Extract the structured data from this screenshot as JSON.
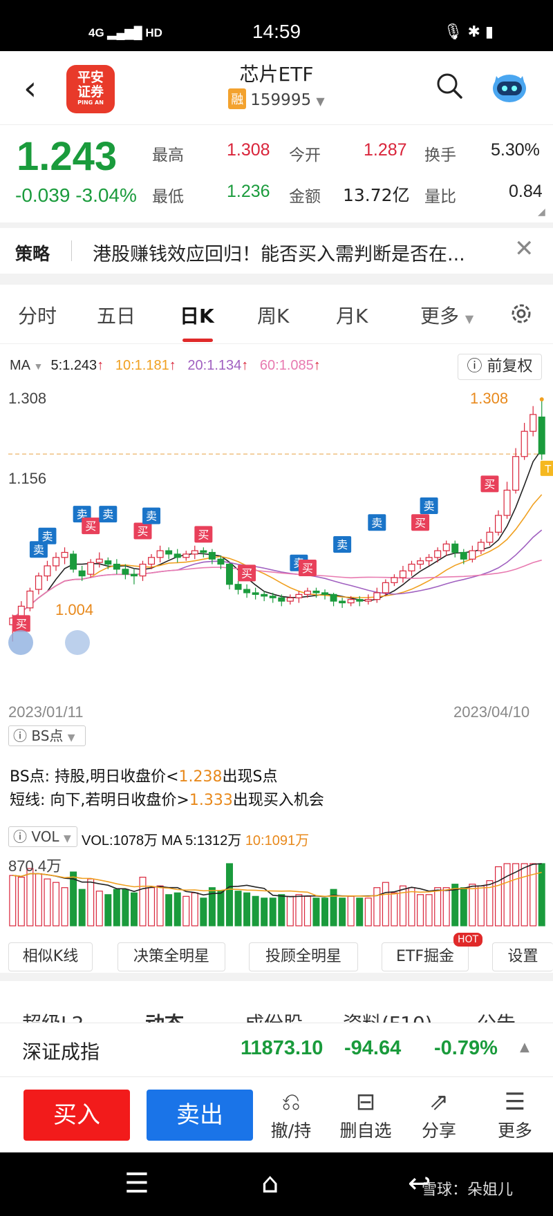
{
  "status": {
    "time": "14:59",
    "network": "4G",
    "hd": "HD"
  },
  "header": {
    "title": "芯片ETF",
    "badge": "融",
    "code": "159995",
    "logo_line1": "平安",
    "logo_line2": "证券",
    "logo_en": "PING AN"
  },
  "quote": {
    "price": "1.243",
    "change": "-0.039",
    "change_pct": "-3.04%",
    "high_label": "最高",
    "high": "1.308",
    "open_label": "今开",
    "open": "1.287",
    "turnover_label": "换手",
    "turnover": "5.30%",
    "low_label": "最低",
    "low": "1.236",
    "amount_label": "金额",
    "amount": "13.72亿",
    "ratio_label": "量比",
    "ratio": "0.84"
  },
  "strategy": {
    "label": "策略",
    "text": "港股赚钱效应回归！能否买入需判断是否在..."
  },
  "tabs": [
    "分时",
    "五日",
    "日K",
    "周K",
    "月K",
    "更多"
  ],
  "chart": {
    "ma_label": "MA",
    "ma5": "5:1.243",
    "ma10": "10:1.181",
    "ma20": "20:1.134",
    "ma60": "60:1.085",
    "fq_label": "前复权",
    "price_top": "1.308",
    "price_mid": "1.156",
    "price_low": "1.004",
    "price_max_tag": "1.308",
    "date_start": "2023/01/11",
    "date_end": "2023/04/10",
    "buy_tag": "买",
    "sell_tag": "卖",
    "t_tag": "T",
    "b_tag": "B",
    "bs_label": "BS点",
    "bs_prefix": "BS点: 持股,明日收盘价<",
    "bs_value": "1.238",
    "bs_suffix": "出现S点",
    "short_prefix": "短线: 向下,若明日收盘价>",
    "short_value": "1.333",
    "short_suffix": "出现买入机会",
    "vol_label": "VOL",
    "vol_text": "VOL:1078万 MA 5:1312万 ",
    "vol_ma10": "10:1091万",
    "vol_max": "870.4万",
    "colors": {
      "up": "#d9243a",
      "down": "#1a9b3c",
      "ma5": "#222222",
      "ma10": "#f0a020",
      "ma20": "#a060c0",
      "ma60": "#e87ab0"
    }
  },
  "chart_data": {
    "type": "candlestick",
    "x_start": "2023/01/11",
    "x_end": "2023/04/10",
    "ylim": [
      1.004,
      1.308
    ],
    "candles": [
      [
        1.04,
        1.048,
        1.02,
        1.052
      ],
      [
        1.048,
        1.062,
        1.044,
        1.068
      ],
      [
        1.06,
        1.08,
        1.056,
        1.084
      ],
      [
        1.082,
        1.098,
        1.076,
        1.102
      ],
      [
        1.098,
        1.11,
        1.092,
        1.116
      ],
      [
        1.11,
        1.12,
        1.104,
        1.126
      ],
      [
        1.12,
        1.126,
        1.112,
        1.132
      ],
      [
        1.124,
        1.106,
        1.102,
        1.128
      ],
      [
        1.104,
        1.098,
        1.092,
        1.11
      ],
      [
        1.1,
        1.114,
        1.096,
        1.118
      ],
      [
        1.114,
        1.118,
        1.108,
        1.126
      ],
      [
        1.116,
        1.112,
        1.106,
        1.12
      ],
      [
        1.112,
        1.106,
        1.1,
        1.118
      ],
      [
        1.106,
        1.1,
        1.094,
        1.112
      ],
      [
        1.1,
        1.098,
        1.088,
        1.106
      ],
      [
        1.098,
        1.112,
        1.092,
        1.116
      ],
      [
        1.112,
        1.12,
        1.106,
        1.124
      ],
      [
        1.12,
        1.128,
        1.114,
        1.134
      ],
      [
        1.128,
        1.124,
        1.118,
        1.132
      ],
      [
        1.124,
        1.12,
        1.114,
        1.13
      ],
      [
        1.12,
        1.124,
        1.116,
        1.128
      ],
      [
        1.124,
        1.128,
        1.118,
        1.134
      ],
      [
        1.128,
        1.126,
        1.12,
        1.132
      ],
      [
        1.126,
        1.118,
        1.112,
        1.13
      ],
      [
        1.118,
        1.112,
        1.106,
        1.122
      ],
      [
        1.112,
        1.088,
        1.082,
        1.114
      ],
      [
        1.088,
        1.082,
        1.076,
        1.092
      ],
      [
        1.082,
        1.078,
        1.072,
        1.088
      ],
      [
        1.078,
        1.076,
        1.07,
        1.084
      ],
      [
        1.076,
        1.074,
        1.068,
        1.08
      ],
      [
        1.074,
        1.072,
        1.066,
        1.078
      ],
      [
        1.072,
        1.068,
        1.062,
        1.076
      ],
      [
        1.068,
        1.072,
        1.064,
        1.076
      ],
      [
        1.072,
        1.076,
        1.066,
        1.08
      ],
      [
        1.076,
        1.08,
        1.072,
        1.084
      ],
      [
        1.08,
        1.078,
        1.072,
        1.084
      ],
      [
        1.078,
        1.076,
        1.07,
        1.082
      ],
      [
        1.076,
        1.068,
        1.062,
        1.078
      ],
      [
        1.068,
        1.066,
        1.06,
        1.072
      ],
      [
        1.066,
        1.07,
        1.062,
        1.074
      ],
      [
        1.07,
        1.068,
        1.062,
        1.074
      ],
      [
        1.068,
        1.07,
        1.064,
        1.076
      ],
      [
        1.07,
        1.078,
        1.066,
        1.084
      ],
      [
        1.078,
        1.09,
        1.074,
        1.094
      ],
      [
        1.09,
        1.096,
        1.086,
        1.1
      ],
      [
        1.096,
        1.104,
        1.09,
        1.11
      ],
      [
        1.104,
        1.112,
        1.098,
        1.116
      ],
      [
        1.112,
        1.116,
        1.106,
        1.12
      ],
      [
        1.116,
        1.12,
        1.11,
        1.124
      ],
      [
        1.12,
        1.128,
        1.114,
        1.132
      ],
      [
        1.128,
        1.136,
        1.122,
        1.14
      ],
      [
        1.136,
        1.126,
        1.12,
        1.14
      ],
      [
        1.126,
        1.118,
        1.112,
        1.13
      ],
      [
        1.118,
        1.128,
        1.114,
        1.134
      ],
      [
        1.128,
        1.138,
        1.124,
        1.142
      ],
      [
        1.138,
        1.15,
        1.134,
        1.156
      ],
      [
        1.15,
        1.17,
        1.146,
        1.176
      ],
      [
        1.17,
        1.2,
        1.166,
        1.21
      ],
      [
        1.2,
        1.24,
        1.196,
        1.25
      ],
      [
        1.24,
        1.27,
        1.236,
        1.28
      ],
      [
        1.27,
        1.29,
        1.264,
        1.3
      ],
      [
        1.287,
        1.243,
        1.236,
        1.308
      ]
    ],
    "volume_max_label": "870.4万"
  }
}
